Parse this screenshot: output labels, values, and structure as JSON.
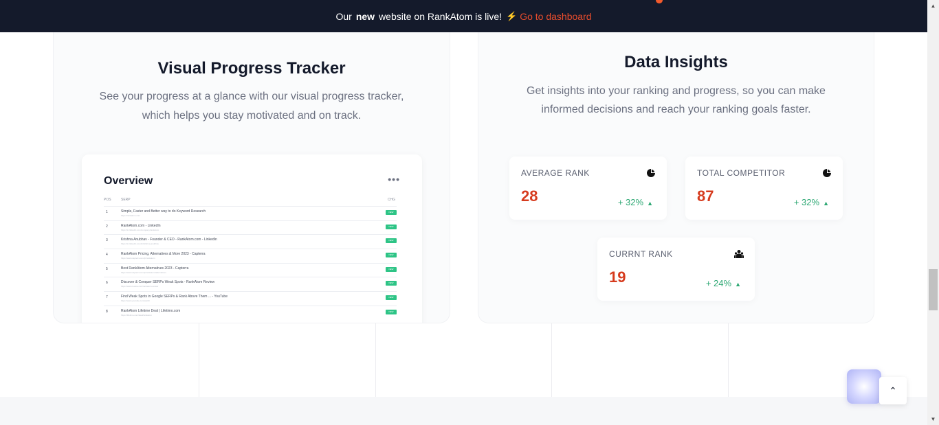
{
  "banner": {
    "prefix": "Our",
    "highlight": "new",
    "suffix": "website on RankAtom is live!",
    "link_icon": "lightning-icon",
    "link_label": "Go to dashboard"
  },
  "left_card": {
    "title": "Visual Progress Tracker",
    "description": "See your progress at a glance with our visual progress tracker, which helps you stay motivated and on track.",
    "overview": {
      "title": "Overview",
      "more_icon": "more-dots-icon",
      "columns": {
        "pos": "POS",
        "serp": "SERP",
        "chg": "CHG"
      },
      "rows": [
        {
          "pos": "1",
          "title": "Simple, Faster and Better way to do Keyword Research",
          "url": "https://rankatom.com",
          "chg": "NEW"
        },
        {
          "pos": "2",
          "title": "RankAtom.com - LinkedIn",
          "url": "https://in.linkedin.com/company/rankatom",
          "chg": "NEW"
        },
        {
          "pos": "3",
          "title": "Krishna Anubhav - Founder & CEO - RankAtom.com - LinkedIn",
          "url": "https://in.linkedin.com/in/krishna-anubhav",
          "chg": "NEW"
        },
        {
          "pos": "4",
          "title": "RankAtom Pricing, Alternatives & More 2023 - Capterra",
          "url": "https://www.capterra.com/p/rankatom",
          "chg": "NEW"
        },
        {
          "pos": "5",
          "title": "Best RankAtom Alternatives 2023 - Capterra",
          "url": "https://www.capterra.com/p/rankatom/alternatives",
          "chg": "NEW"
        },
        {
          "pos": "6",
          "title": "Discover & Conquer SERPs Weak Spots - RankAtom Review",
          "url": "https://www.review.com/rankatom-review",
          "chg": "NEW"
        },
        {
          "pos": "7",
          "title": "Find Weak Spots in Google SERPs & Rank Above Them ... - YouTube",
          "url": "https://www.youtube.com/watch",
          "chg": "NEW"
        },
        {
          "pos": "8",
          "title": "RankAtom Lifetime Deal | Lifetimo.com",
          "url": "https://lifetimo.com/deal/rankatom",
          "chg": "NEW"
        }
      ]
    }
  },
  "right_card": {
    "title": "Data Insights",
    "description": "Get insights into your ranking and progress, so you can make informed decisions and reach your ranking goals faster.",
    "stats": {
      "average": {
        "label": "AVERAGE RANK",
        "value": "28",
        "change": "+ 32%",
        "icon": "pie-chart-icon"
      },
      "total": {
        "label": "TOTAL COMPETITOR",
        "value": "87",
        "change": "+ 32%",
        "icon": "pie-chart-icon"
      },
      "current": {
        "label": "CURRNT RANK",
        "value": "19",
        "change": "+ 24%",
        "icon": "users-icon"
      }
    },
    "up_arrow": "▲"
  },
  "widgets": {
    "chat_icon": "assistant-orb-icon",
    "scroll_top_label": "⌃"
  },
  "colors": {
    "banner_bg": "#141a2b",
    "accent": "#e84d2d",
    "value_red": "#d63b1e",
    "positive_green": "#2ea874",
    "badge_green": "#2ec486"
  }
}
